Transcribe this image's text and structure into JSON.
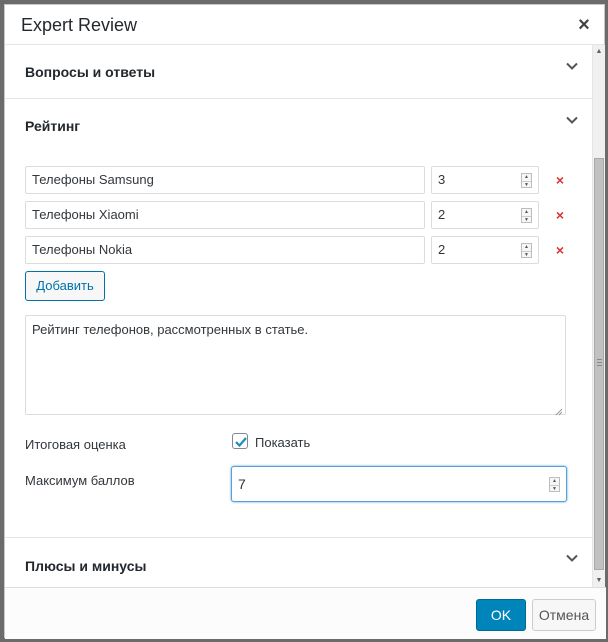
{
  "dialog": {
    "title": "Expert Review",
    "close_icon": "×"
  },
  "sections": {
    "qa": {
      "title": "Вопросы и ответы",
      "expanded": false
    },
    "rating": {
      "title": "Рейтинг",
      "expanded": true
    },
    "pros_cons": {
      "title": "Плюсы и минусы",
      "expanded": false
    }
  },
  "rating": {
    "items": [
      {
        "name": "Телефоны Samsung",
        "score": "3"
      },
      {
        "name": "Телефоны Xiaomi",
        "score": "2"
      },
      {
        "name": "Телефоны Nokia",
        "score": "2"
      }
    ],
    "remove_icon": "×",
    "add_label": "Добавить",
    "description": "Рейтинг телефонов, рассмотренных в статье.",
    "total_label": "Итоговая оценка",
    "show_label": "Показать",
    "show_checked": true,
    "max_label": "Максимум баллов",
    "max_value": "7"
  },
  "footer": {
    "ok_label": "OK",
    "cancel_label": "Отмена"
  },
  "colors": {
    "primary": "#0085ba",
    "remove": "#dc3232",
    "link": "#0073aa"
  },
  "icons": {
    "chevron": "chevron-down-icon",
    "close": "close-icon",
    "remove": "remove-icon",
    "check": "checkmark-icon"
  }
}
